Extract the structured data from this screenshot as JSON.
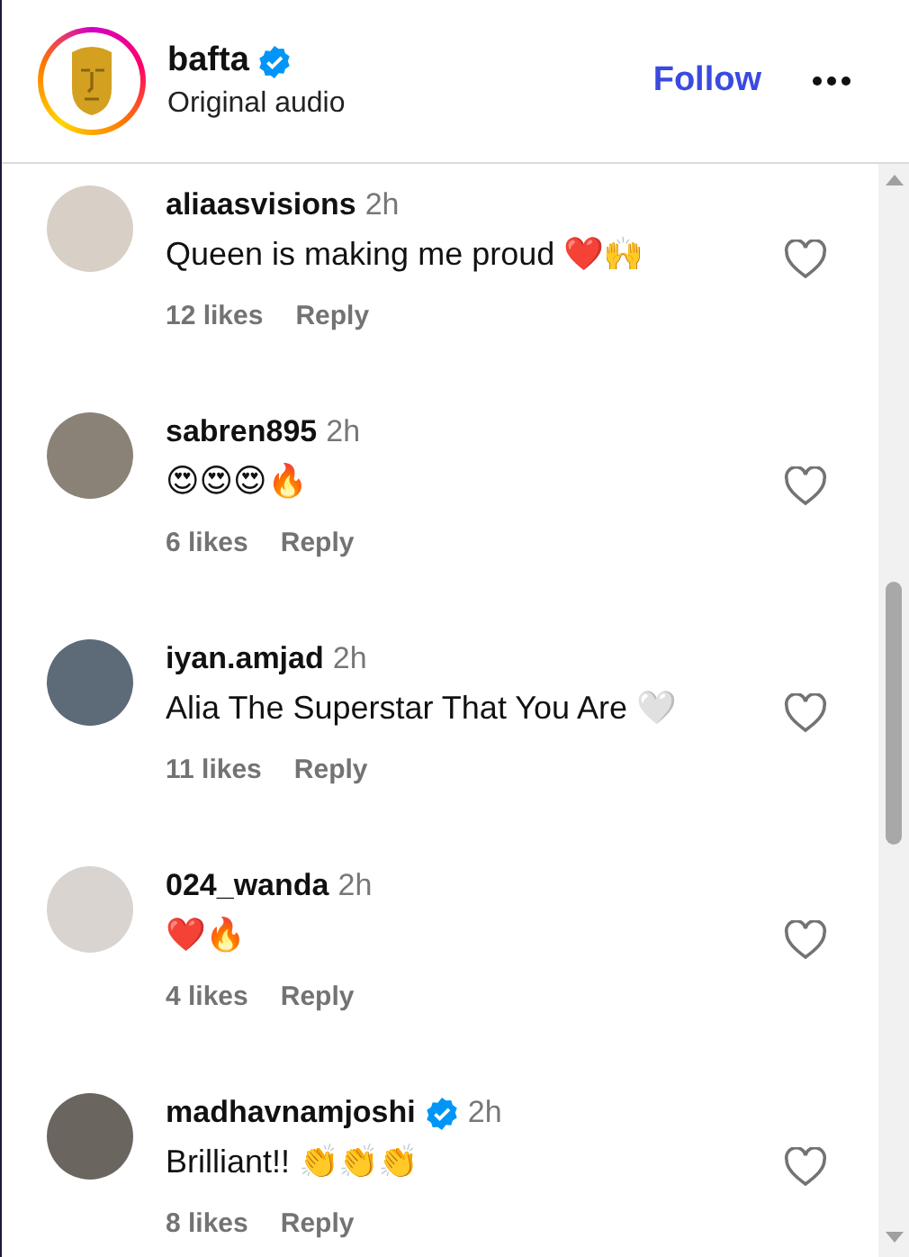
{
  "header": {
    "username": "bafta",
    "verified": true,
    "subtitle": "Original audio",
    "follow": "Follow"
  },
  "comments": [
    {
      "username": "aliaasvisions",
      "verified": false,
      "time": "2h",
      "text": "Queen is making me proud ❤️🙌",
      "likes": "12 likes",
      "reply": "Reply",
      "liked": false
    },
    {
      "username": "sabren895",
      "verified": false,
      "time": "2h",
      "text": "😍😍😍🔥",
      "likes": "6 likes",
      "reply": "Reply",
      "liked": false
    },
    {
      "username": "iyan.amjad",
      "verified": false,
      "time": "2h",
      "text": "Alia The Superstar That You Are 🤍",
      "likes": "11 likes",
      "reply": "Reply",
      "liked": false
    },
    {
      "username": "024_wanda",
      "verified": false,
      "time": "2h",
      "text": "❤️🔥",
      "likes": "4 likes",
      "reply": "Reply",
      "liked": false
    },
    {
      "username": "madhavnamjoshi",
      "verified": true,
      "time": "2h",
      "text": "Brilliant!! 👏👏👏",
      "likes": "8 likes",
      "reply": "Reply",
      "liked": false
    }
  ]
}
